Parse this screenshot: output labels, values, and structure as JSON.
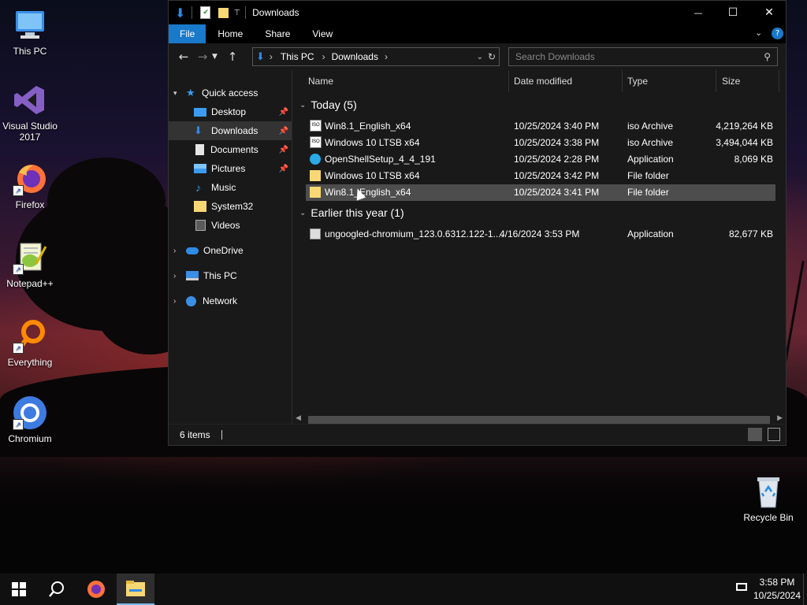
{
  "desktop": {
    "icons": [
      {
        "label": "This PC"
      },
      {
        "label": "Visual Studio 2017"
      },
      {
        "label": "Firefox"
      },
      {
        "label": "Notepad++"
      },
      {
        "label": "Everything"
      },
      {
        "label": "Chromium"
      },
      {
        "label": "Recycle Bin"
      }
    ]
  },
  "window": {
    "title": "Downloads",
    "controls": {
      "minimize": "—",
      "maximize": "☐",
      "close": "✕"
    },
    "ribbon_tabs": [
      "File",
      "Home",
      "Share",
      "View"
    ],
    "address": {
      "crumbs": [
        "This PC",
        "Downloads"
      ],
      "sep": "›"
    },
    "search_placeholder": "Search Downloads",
    "nav": {
      "quick_access": "Quick access",
      "items": [
        {
          "label": "Desktop",
          "pinned": true
        },
        {
          "label": "Downloads",
          "pinned": true
        },
        {
          "label": "Documents",
          "pinned": true
        },
        {
          "label": "Pictures",
          "pinned": true
        },
        {
          "label": "Music",
          "pinned": false
        },
        {
          "label": "System32",
          "pinned": false
        },
        {
          "label": "Videos",
          "pinned": false
        }
      ],
      "roots": [
        {
          "label": "OneDrive"
        },
        {
          "label": "This PC"
        },
        {
          "label": "Network"
        }
      ]
    },
    "columns": [
      "Name",
      "Date modified",
      "Type",
      "Size"
    ],
    "groups": [
      {
        "label": "Today (5)",
        "files": [
          {
            "name": "Win8.1_English_x64",
            "date": "10/25/2024 3:40 PM",
            "type": "iso Archive",
            "size": "4,219,264 KB",
            "icon": "iso-icon"
          },
          {
            "name": "Windows 10 LTSB x64",
            "date": "10/25/2024 3:38 PM",
            "type": "iso Archive",
            "size": "3,494,044 KB",
            "icon": "iso-icon"
          },
          {
            "name": "OpenShellSetup_4_4_191",
            "date": "10/25/2024 2:28 PM",
            "type": "Application",
            "size": "8,069 KB",
            "icon": "shell-icon"
          },
          {
            "name": "Windows 10 LTSB x64",
            "date": "10/25/2024 3:42 PM",
            "type": "File folder",
            "size": "",
            "icon": "folder-icon"
          },
          {
            "name": "Win8.1_English_x64",
            "date": "10/25/2024 3:41 PM",
            "type": "File folder",
            "size": "",
            "icon": "folder-icon"
          }
        ]
      },
      {
        "label": "Earlier this year (1)",
        "files": [
          {
            "name": "ungoogled-chromium_123.0.6312.122-1....",
            "date": "4/16/2024 3:53 PM",
            "type": "Application",
            "size": "82,677 KB",
            "icon": "installer-icon"
          }
        ]
      }
    ],
    "status": {
      "count": "6 items"
    }
  },
  "taskbar": {
    "time": "3:58 PM",
    "date": "10/25/2024"
  },
  "colors": {
    "accent": "#1979ca",
    "selection": "#4d4d4d",
    "folder": "#f8d775"
  }
}
